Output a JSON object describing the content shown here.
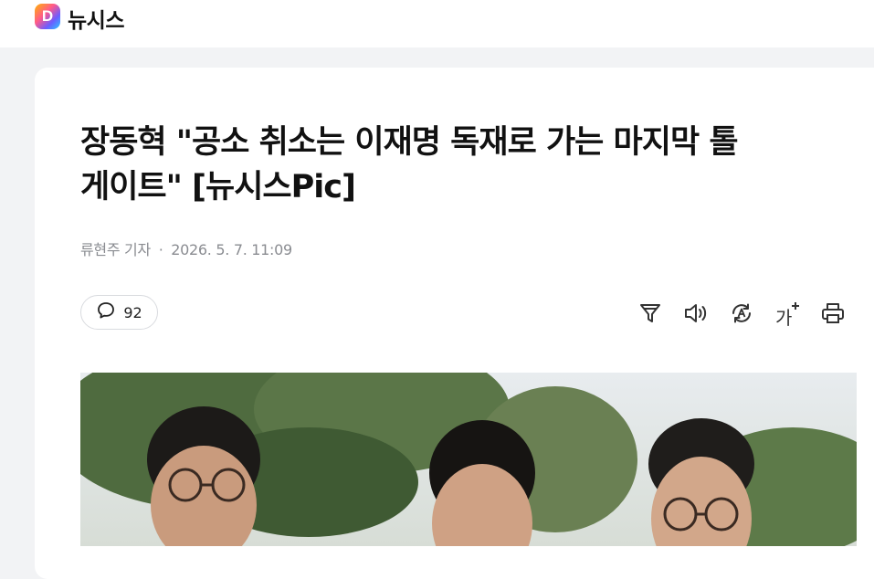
{
  "header": {
    "logo_letter": "D",
    "brand_name": "뉴시스"
  },
  "article": {
    "title_line1": "장동혁 \"공소 취소는 이재명 독재로 가는 마지막 톨",
    "title_line2": "게이트\" [뉴시스Pic]",
    "author": "류현주 기자",
    "separator": "·",
    "datetime": "2026. 5. 7. 11:09",
    "comment_count": "92"
  },
  "toolbar": {
    "icons": [
      "filter-icon",
      "speaker-icon",
      "translate-icon",
      "font-size-icon",
      "print-icon"
    ],
    "font_size_label": "가"
  },
  "colors": {
    "accent_text": "#111111",
    "muted_text": "#8a8c91",
    "page_bg": "#f2f3f5"
  }
}
